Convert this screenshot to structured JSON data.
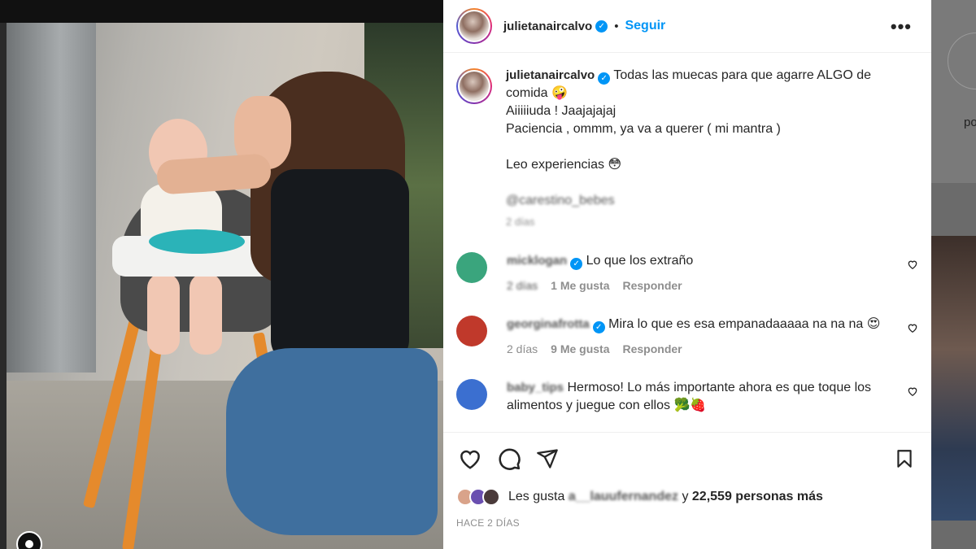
{
  "post": {
    "username": "julietanaircalvo",
    "follow_label": "Seguir",
    "more_label": "•••",
    "separator": "•",
    "caption": {
      "line1": "Todas las muecas para que agarre ALGO de comida 🤪",
      "line2": "Aiiiiiuda ! Jaajajajaj",
      "line3": "Paciencia , ommm, ya va a querer ( mi mantra )",
      "line4": "Leo experiencias 😳",
      "mention": "@carestino_bebes",
      "time": "2 días"
    },
    "comments": [
      {
        "username": "micklogan",
        "verified": true,
        "text": "Lo que los extraño",
        "time": "2 días",
        "likes": "1 Me gusta",
        "reply": "Responder",
        "avatar_color": "#3aa57d"
      },
      {
        "username": "georginafrotta",
        "verified": true,
        "text": "Mira lo que es esa empanadaaaaa na na na 😍",
        "time": "2 días",
        "likes": "9 Me gusta",
        "reply": "Responder",
        "avatar_color": "#c0392b"
      },
      {
        "username": "baby_tips",
        "verified": false,
        "text": "Hermoso! Lo más importante ahora es que toque los alimentos y juegue con ellos 🥦🍓",
        "avatar_color": "#3b6fd0"
      }
    ],
    "liked_by_prefix": "Les gusta",
    "liked_by_user": "a__lauufernandez",
    "liked_by_suffix": "y",
    "liked_count": "22,559 personas más",
    "posted_ago": "HACE 2 DÍAS"
  },
  "side": {
    "peek_text": "po"
  },
  "colors": {
    "accent": "#0095f6",
    "text": "#262626",
    "muted": "#8e8e8e"
  },
  "icons": [
    "heart-icon",
    "comment-icon",
    "share-icon",
    "bookmark-icon",
    "verified-icon",
    "more-icon"
  ]
}
